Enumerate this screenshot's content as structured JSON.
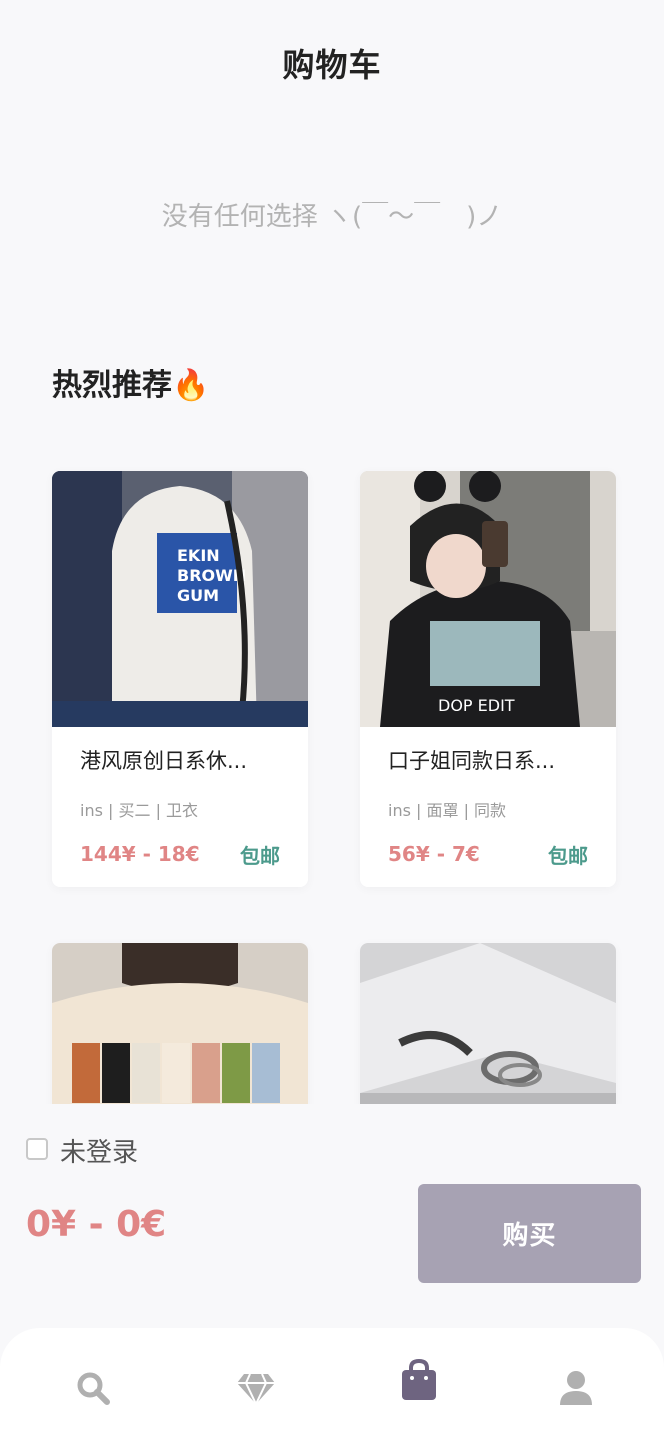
{
  "header": {
    "title": "购物车"
  },
  "cart": {
    "empty_message": "没有任何选择 ヽ(￣～￣　)ノ"
  },
  "recommend": {
    "title": "热烈推荐🔥",
    "items": [
      {
        "name": "港风原创日系休...",
        "tags": "ins | 买二 | 卫衣",
        "price": "144¥ - 18€",
        "shipping": "包邮"
      },
      {
        "name": "口子姐同款日系...",
        "tags": "ins | 面罩 | 同款",
        "price": "56¥ - 7€",
        "shipping": "包邮"
      },
      {
        "name": "",
        "tags": "",
        "price": "",
        "shipping": ""
      },
      {
        "name": "",
        "tags": "",
        "price": "",
        "shipping": ""
      }
    ]
  },
  "footer": {
    "login_label": "未登录",
    "login_checked": false,
    "total": "0¥ - 0€",
    "buy_label": "购买"
  },
  "tabs": [
    {
      "icon": "search-icon",
      "active": false
    },
    {
      "icon": "diamond-icon",
      "active": false
    },
    {
      "icon": "shopping-bag-icon",
      "active": true
    },
    {
      "icon": "user-icon",
      "active": false
    }
  ],
  "colors": {
    "price": "#e08585",
    "shipping": "#4c9a8c",
    "buy_button": "#a7a2b3",
    "tab_active": "#6e6480",
    "tab_inactive": "#b0b0b0"
  }
}
